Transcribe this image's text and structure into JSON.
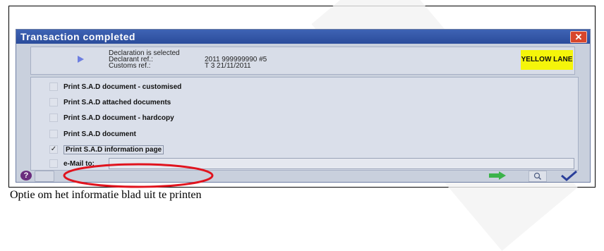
{
  "dialog": {
    "title": "Transaction completed",
    "close_label": "✕"
  },
  "info": {
    "status": "Declaration is selected",
    "declarant_label": "Declarant ref.:",
    "declarant_value": "2011 999999990 #5",
    "customs_label": "Customs ref.:",
    "customs_value": "T 3 21/11/2011",
    "lane": "YELLOW LANE",
    "lane_color": "#f5f50a"
  },
  "options": [
    {
      "label": "Print S.A.D document - customised",
      "checked": false,
      "mark": ""
    },
    {
      "label": "Print S.A.D attached documents",
      "checked": false,
      "mark": ""
    },
    {
      "label": "Print S.A.D document - hardcopy",
      "checked": false,
      "mark": ""
    },
    {
      "label": "Print S.A.D document",
      "checked": false,
      "mark": ""
    },
    {
      "label": "Print S.A.D information page",
      "checked": true,
      "mark": "✓"
    },
    {
      "label": "e-Mail to:",
      "checked": false,
      "mark": ""
    }
  ],
  "email_value": "",
  "toolbar": {
    "help_label": "?"
  },
  "caption": "Optie om het informatie blad uit te printen",
  "colors": {
    "titlebar": "#2b4c9b",
    "highlight": "#e0141e",
    "next_arrow": "#3bb34a",
    "ok_check": "#2a3f9a"
  }
}
